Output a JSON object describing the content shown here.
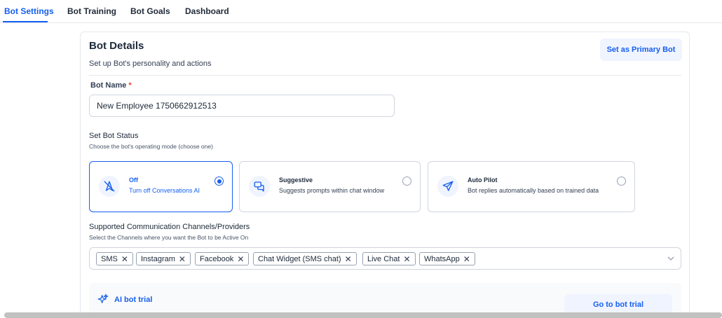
{
  "tabs": [
    {
      "label": "Bot Settings",
      "active": true
    },
    {
      "label": "Bot Training",
      "active": false
    },
    {
      "label": "Bot Goals",
      "active": false
    },
    {
      "label": "Dashboard",
      "active": false
    }
  ],
  "card": {
    "title": "Bot Details",
    "subtitle": "Set up Bot's personality and actions",
    "primary_button": "Set as Primary Bot"
  },
  "bot_name": {
    "label": "Bot Name",
    "required_mark": "*",
    "value": "New Employee 1750662912513"
  },
  "status": {
    "title": "Set Bot Status",
    "hint": "Choose the bot's operating mode (choose one)",
    "options": [
      {
        "name": "Off",
        "description": "Turn off Conversations AI",
        "selected": true,
        "icon": "bot-off-icon"
      },
      {
        "name": "Suggestive",
        "description": "Suggests prompts within chat window",
        "selected": false,
        "icon": "chat-bubbles-icon"
      },
      {
        "name": "Auto Pilot",
        "description": "Bot replies automatically based on trained data",
        "selected": false,
        "icon": "send-icon"
      }
    ]
  },
  "channels": {
    "title": "Supported Communication Channels/Providers",
    "hint": "Select the Channels where you want the Bot to be Active On",
    "chips": [
      "SMS",
      "Instagram",
      "Facebook",
      "Chat Widget (SMS chat)",
      "Live Chat",
      "WhatsApp"
    ],
    "remove_glyph": "✕"
  },
  "trial": {
    "label": "AI bot trial",
    "button": "Go to bot trial"
  },
  "colors": {
    "accent": "#155eef",
    "accent_light": "#eff4ff",
    "border": "#d0d5dd",
    "required": "#f04438"
  }
}
